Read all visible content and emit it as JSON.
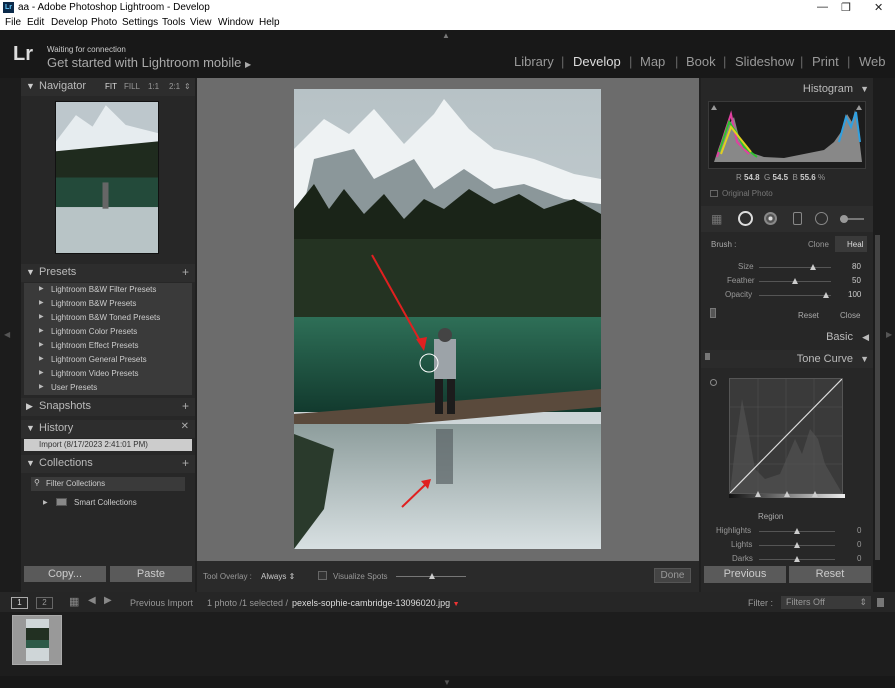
{
  "window": {
    "title": "aa - Adobe Photoshop Lightroom - Develop",
    "min": "—",
    "restore": "❐",
    "close": "✕"
  },
  "menu": [
    "File",
    "Edit",
    "Develop",
    "Photo",
    "Settings",
    "Tools",
    "View",
    "Window",
    "Help"
  ],
  "identity": {
    "logo": "Lr",
    "status": "Waiting for connection",
    "message": "Get started with Lightroom mobile",
    "message_arrow": "▶"
  },
  "modules": [
    "Library",
    "Develop",
    "Map",
    "Book",
    "Slideshow",
    "Print",
    "Web"
  ],
  "active_module": "Develop",
  "navigator": {
    "title": "Navigator",
    "zoom": [
      "FIT",
      "FILL",
      "1:1",
      "2:1"
    ],
    "active_zoom": "FIT",
    "zoom_arrows": "⇕"
  },
  "presets": {
    "title": "Presets",
    "items": [
      "Lightroom B&W Filter Presets",
      "Lightroom B&W Presets",
      "Lightroom B&W Toned Presets",
      "Lightroom Color Presets",
      "Lightroom Effect Presets",
      "Lightroom General Presets",
      "Lightroom Video Presets",
      "User Presets"
    ]
  },
  "snapshots": {
    "title": "Snapshots"
  },
  "history": {
    "title": "History",
    "items": [
      "Import (8/17/2023 2:41:01 PM)"
    ]
  },
  "collections": {
    "title": "Collections",
    "filter": "Filter Collections",
    "smart": "Smart Collections"
  },
  "left_buttons": {
    "copy": "Copy...",
    "paste": "Paste"
  },
  "toolbar": {
    "overlay_label": "Tool Overlay :",
    "overlay_value": "Always",
    "visualize": "Visualize Spots",
    "done": "Done"
  },
  "histogram": {
    "title": "Histogram",
    "r_label": "R",
    "r": "54.8",
    "g_label": "G",
    "g": "54.5",
    "b_label": "B",
    "b": "55.6",
    "unit": "%",
    "original_photo": "Original Photo"
  },
  "brush": {
    "label": "Brush :",
    "clone": "Clone",
    "heal": "Heal",
    "mode": "Heal",
    "sliders": [
      {
        "name": "Size",
        "value": "80",
        "pos": 0.8
      },
      {
        "name": "Feather",
        "value": "50",
        "pos": 0.5
      },
      {
        "name": "Opacity",
        "value": "100",
        "pos": 1.0
      }
    ],
    "reset": "Reset",
    "close": "Close"
  },
  "basic": {
    "title": "Basic"
  },
  "tone_curve": {
    "title": "Tone Curve",
    "region_title": "Region",
    "region": [
      {
        "name": "Highlights",
        "value": "0",
        "pos": 0.5
      },
      {
        "name": "Lights",
        "value": "0",
        "pos": 0.5
      },
      {
        "name": "Darks",
        "value": "0",
        "pos": 0.5
      }
    ]
  },
  "right_buttons": {
    "previous": "Previous",
    "reset": "Reset"
  },
  "filmstrip": {
    "pages": [
      "1",
      "2"
    ],
    "previous_import": "Previous Import",
    "count": "1 photo /1 selected /",
    "filename": "pexels-sophie-cambridge-13096020.jpg",
    "filter_label": "Filter :",
    "filter_value": "Filters Off"
  }
}
